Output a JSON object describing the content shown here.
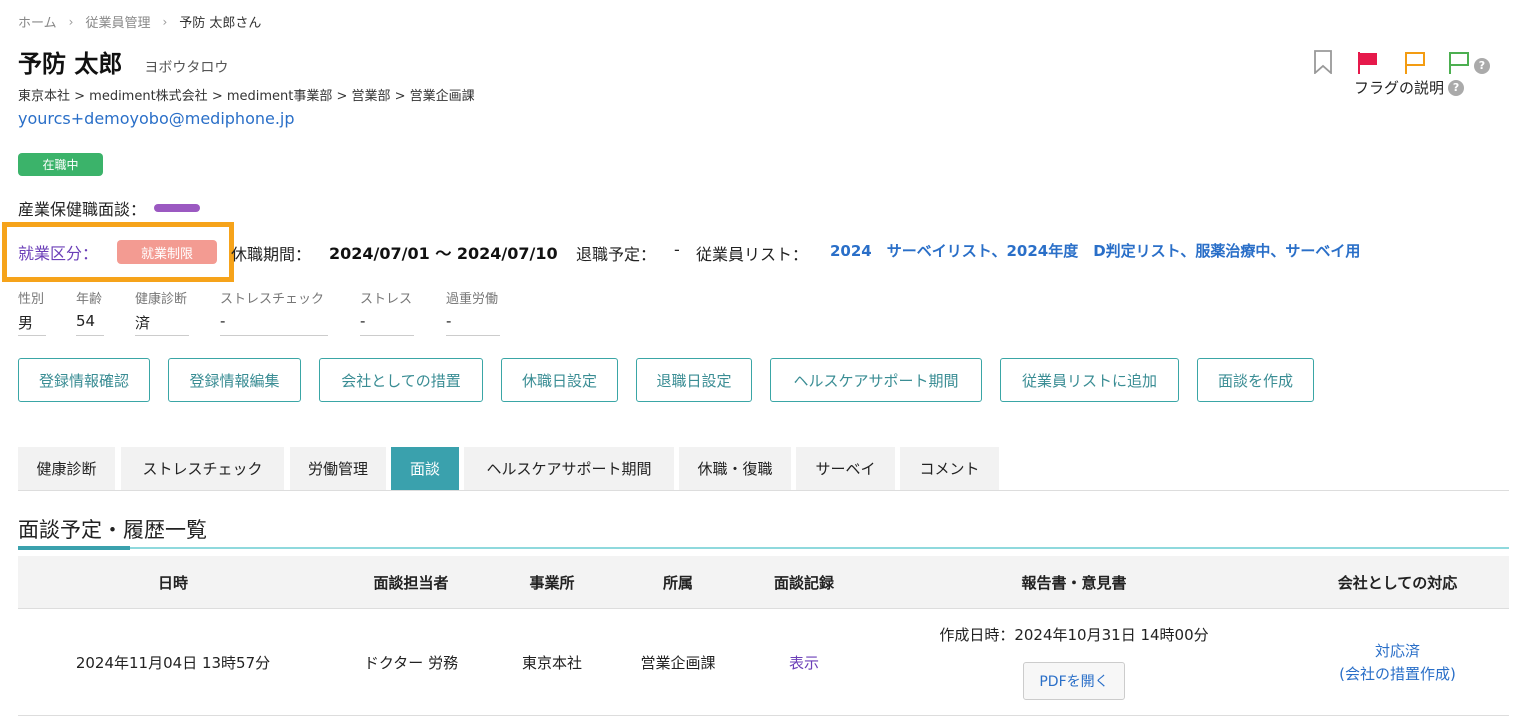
{
  "breadcrumb": {
    "home": "ホーム",
    "section": "従業員管理",
    "current": "予防 太郎さん",
    "sep_glyph": "›"
  },
  "employee": {
    "name": "予防 太郎",
    "kana": "ヨボウタロウ",
    "org_path": "東京本社 > mediment株式会社 > mediment事業部 > 営業部 > 営業企画課",
    "email": "yourcs+demoyobo@mediphone.jp",
    "status": "在職中"
  },
  "counseling": {
    "label": "産業保健職面談：",
    "color": "#9b59c1"
  },
  "work_status": {
    "label": "就業区分：",
    "badge": "就業制限",
    "badge_color": "#f39b92",
    "highlight_color": "#f6a31a"
  },
  "leave": {
    "label": "休職期間：",
    "value": "2024/07/01 〜 2024/07/10"
  },
  "retire": {
    "label": "退職予定：",
    "value": "-"
  },
  "employee_list": {
    "label": "従業員リスト：",
    "value": "2024　サーベイリスト、2024年度　D判定リスト、服薬治療中、サーベイ用"
  },
  "info": [
    {
      "label": "性別",
      "value": "男"
    },
    {
      "label": "年齢",
      "value": "54"
    },
    {
      "label": "健康診断",
      "value": "済"
    },
    {
      "label": "ストレスチェック",
      "value": "-"
    },
    {
      "label": "ストレス",
      "value": "-"
    },
    {
      "label": "過重労働",
      "value": "-"
    }
  ],
  "actions": [
    "登録情報確認",
    "登録情報編集",
    "会社としての措置",
    "休職日設定",
    "退職日設定",
    "ヘルスケアサポート期間",
    "従業員リストに追加",
    "面談を作成"
  ],
  "flags": {
    "bookmark_icon": "bookmark-outline-icon",
    "red_flag_color": "#e6194b",
    "orange_flag_color": "#f39c12",
    "green_flag_color": "#4caf50",
    "help_label": "フラグの説明",
    "help_glyph": "?"
  },
  "tabs": [
    {
      "label": "健康診断",
      "active": false
    },
    {
      "label": "ストレスチェック",
      "active": false
    },
    {
      "label": "労働管理",
      "active": false
    },
    {
      "label": "面談",
      "active": true
    },
    {
      "label": "ヘルスケアサポート期間",
      "active": false
    },
    {
      "label": "休職・復職",
      "active": false
    },
    {
      "label": "サーベイ",
      "active": false
    },
    {
      "label": "コメント",
      "active": false
    }
  ],
  "section": {
    "title": "面談予定・履歴一覧"
  },
  "table": {
    "columns": [
      "日時",
      "面談担当者",
      "事業所",
      "所属",
      "面談記録",
      "報告書・意見書",
      "会社としての対応"
    ],
    "rows": [
      {
        "datetime": "2024年11月04日 13時57分",
        "staff": "ドクター 労務",
        "office": "東京本社",
        "dept": "営業企画課",
        "record": "表示",
        "report_created": "作成日時：2024年10月31日 14時00分",
        "report_button": "PDFを開く",
        "company_status": "対応済",
        "company_action": "(会社の措置作成)"
      }
    ]
  }
}
